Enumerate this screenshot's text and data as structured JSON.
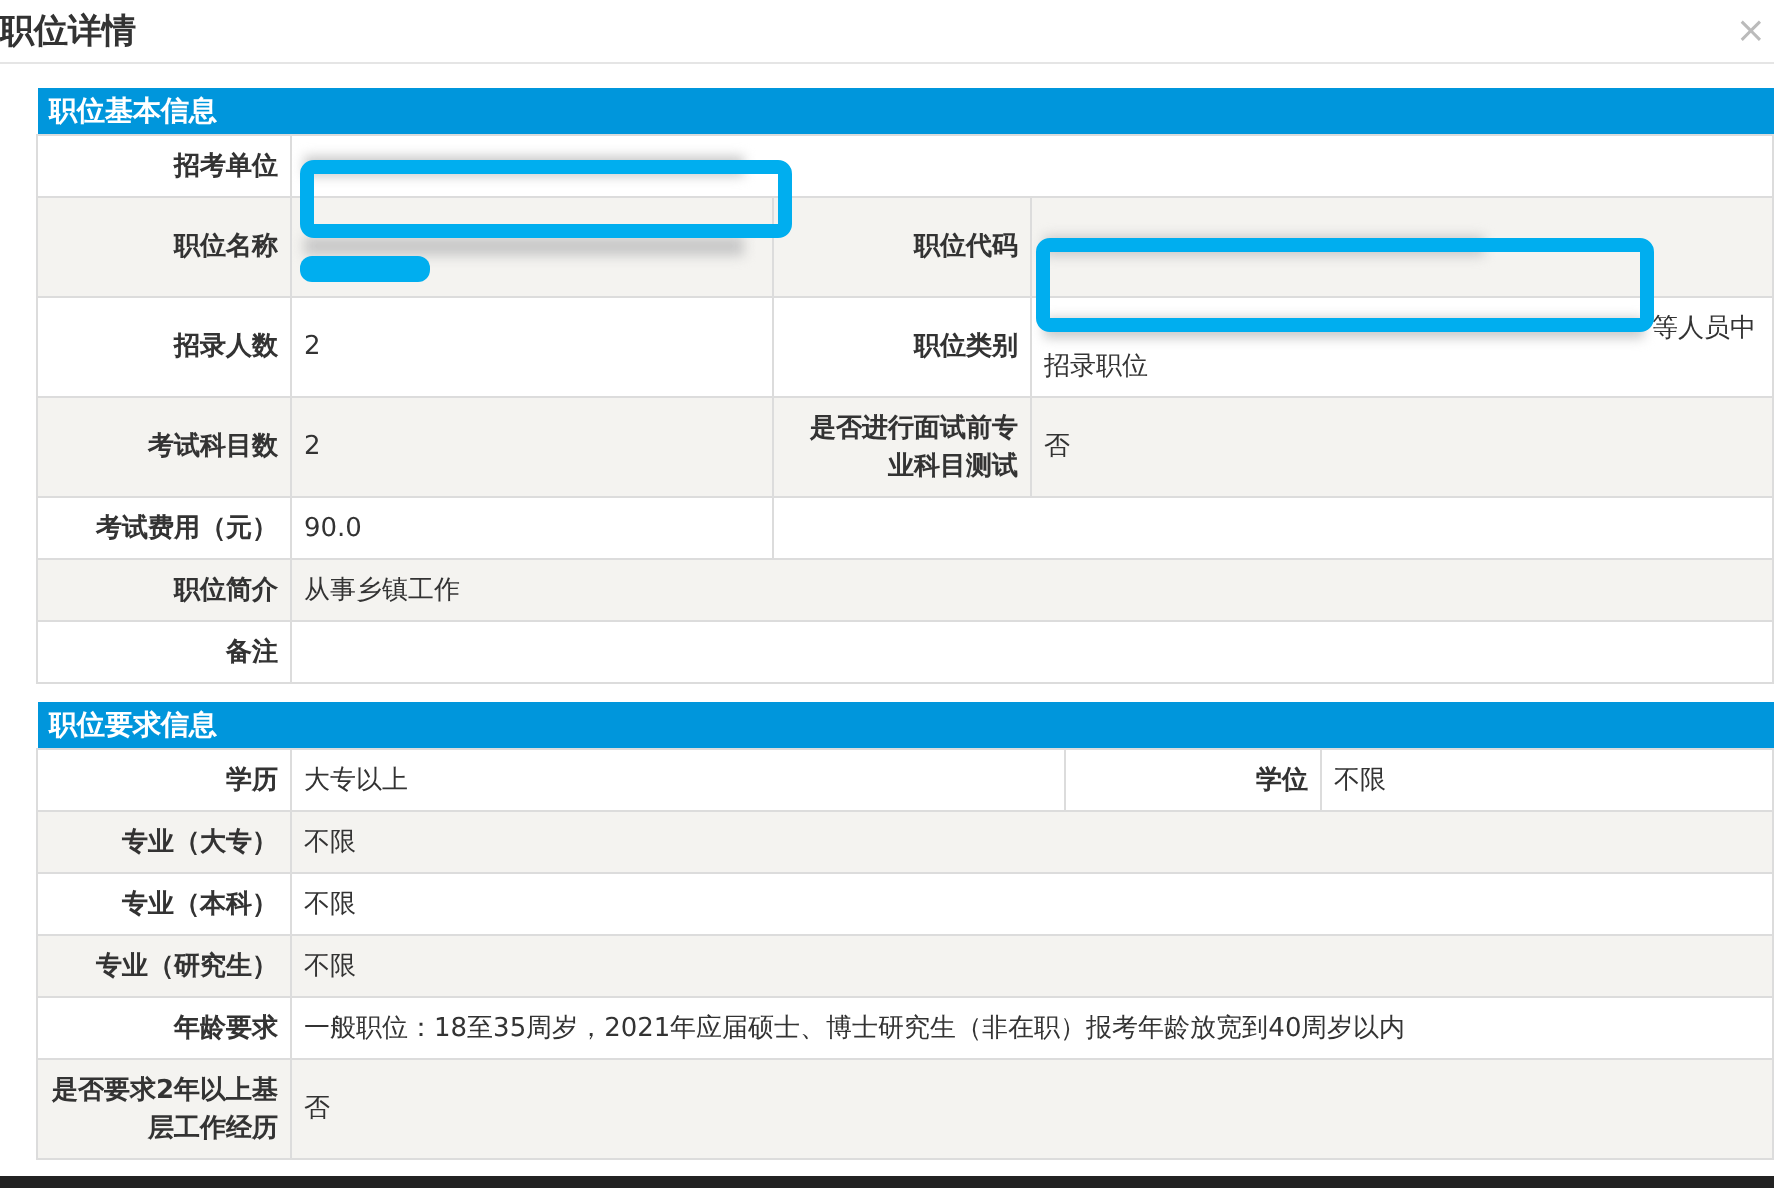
{
  "dialog": {
    "title": "职位详情",
    "close": "×"
  },
  "sections": [
    {
      "title": "职位基本信息",
      "kind": "basic",
      "rows": [
        {
          "kind": "full",
          "pairs": [
            {
              "label": "招考单位",
              "redacted": true
            }
          ]
        },
        {
          "kind": "pair",
          "pairs": [
            {
              "label": "职位名称",
              "redacted": true
            },
            {
              "label": "职位代码",
              "redacted": true
            }
          ]
        },
        {
          "kind": "pair",
          "pairs": [
            {
              "label": "招录人数",
              "value": "2"
            },
            {
              "label": "职位类别",
              "redacted": true,
              "value": "等人员中招录职位"
            }
          ]
        },
        {
          "kind": "pair",
          "pairs": [
            {
              "label": "考试科目数",
              "value": "2"
            },
            {
              "label": "是否进行面试前专业科目测试",
              "value": "否"
            }
          ]
        },
        {
          "kind": "half",
          "pairs": [
            {
              "label": "考试费用（元）",
              "value": "90.0"
            }
          ]
        },
        {
          "kind": "full",
          "pairs": [
            {
              "label": "职位简介",
              "value": "从事乡镇工作"
            }
          ]
        },
        {
          "kind": "full",
          "pairs": [
            {
              "label": "备注"
            }
          ]
        }
      ]
    },
    {
      "title": "职位要求信息",
      "kind": "requirements",
      "rows": [
        {
          "kind": "pair",
          "pairs": [
            {
              "label": "学历",
              "value": "大专以上"
            },
            {
              "label": "学位",
              "value": "不限"
            }
          ]
        },
        {
          "kind": "full",
          "pairs": [
            {
              "label": "专业（大专）",
              "value": "不限"
            }
          ]
        },
        {
          "kind": "full",
          "pairs": [
            {
              "label": "专业（本科）",
              "value": "不限"
            }
          ]
        },
        {
          "kind": "full",
          "pairs": [
            {
              "label": "专业（研究生）",
              "value": "不限"
            }
          ]
        },
        {
          "kind": "full",
          "pairs": [
            {
              "label": "年龄要求",
              "value": "一般职位：18至35周岁，2021年应届硕士、博士研究生（非在职）报考年龄放宽到40周岁以内"
            }
          ]
        },
        {
          "kind": "full",
          "pairs": [
            {
              "label": "是否要求2年以上基层工作经历",
              "value": "否"
            }
          ]
        }
      ]
    }
  ]
}
